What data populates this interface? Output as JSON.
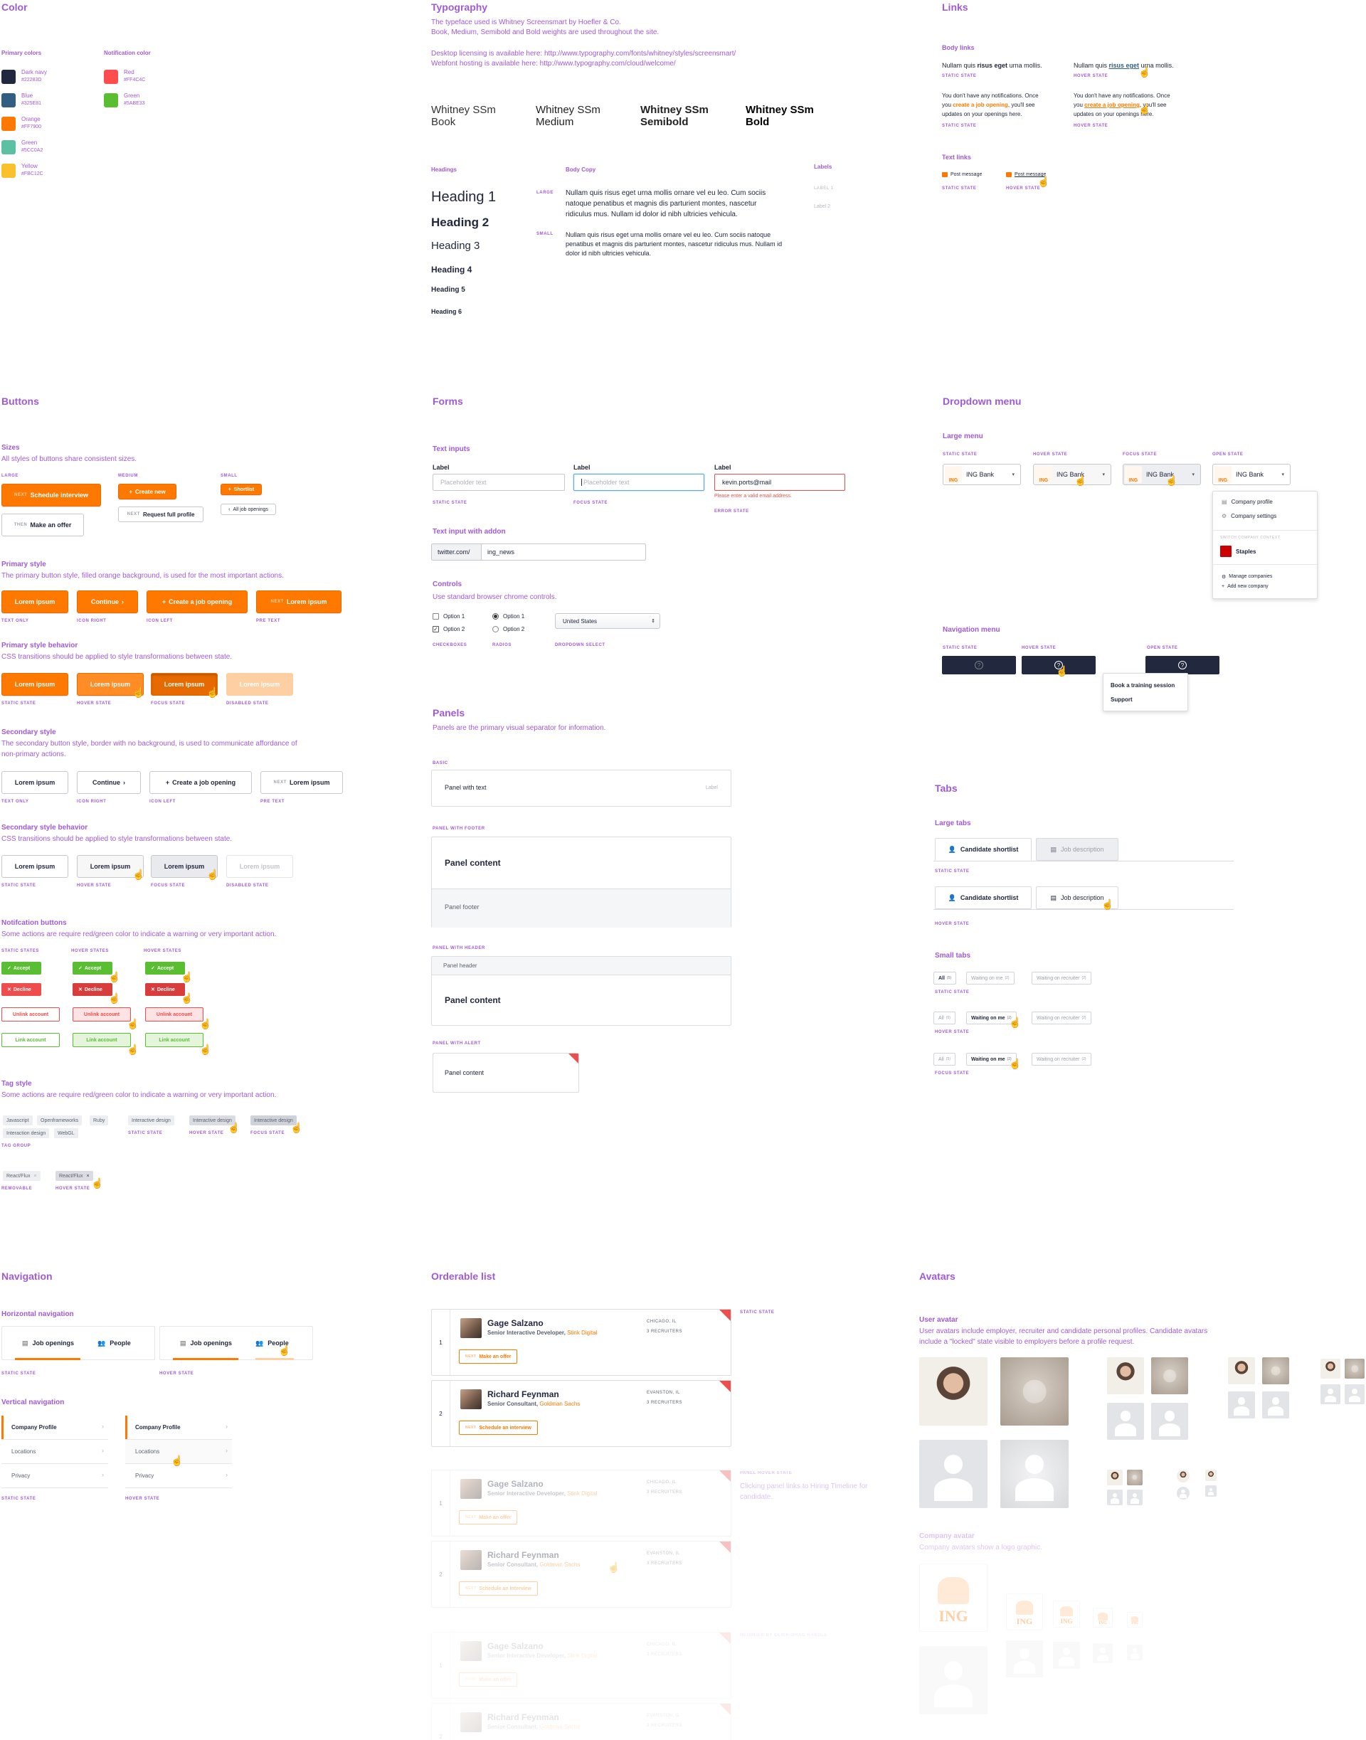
{
  "color": {
    "title": "Color",
    "primary_label": "Primary colors",
    "notification_label": "Notification color",
    "primary": [
      {
        "name": "Dark navy",
        "hex": "#22283D"
      },
      {
        "name": "Blue",
        "hex": "#325E81"
      },
      {
        "name": "Orange",
        "hex": "#FF7900"
      },
      {
        "name": "Green",
        "hex": "#5CC0A2"
      },
      {
        "name": "Yellow",
        "hex": "#FBC12C"
      }
    ],
    "notification": [
      {
        "name": "Red",
        "hex": "#FF4C4C"
      },
      {
        "name": "Green",
        "hex": "#5ABE33"
      }
    ]
  },
  "typography": {
    "title": "Typography",
    "intro1": "The typeface used is Whitney Screensmart by Hoefler & Co.",
    "intro2": "Book, Medium, Semibold and Bold weights are used throughout the site.",
    "link1": "Desktop licensing is available here: http://www.typography.com/fonts/whitney/styles/screensmart/",
    "link2": "Webfont hosting is available here: http://www.typography.com/cloud/welcome/",
    "weights": [
      "Whitney SSm Book",
      "Whitney SSm Medium",
      "Whitney SSm Semibold",
      "Whitney SSm Bold"
    ],
    "headings_label": "Headings",
    "headings": [
      "Heading 1",
      "Heading 2",
      "Heading 3",
      "Heading 4",
      "Heading 5",
      "Heading 6"
    ],
    "body_label": "Body Copy",
    "large_label": "LARGE",
    "small_label": "SMALL",
    "body_large": "Nullam quis risus eget urna mollis ornare vel eu leo. Cum sociis natoque penatibus et magnis dis parturient montes, nascetur ridiculus mus. Nullam id dolor id nibh ultricies vehicula.",
    "body_small": "Nullam quis risus eget urna mollis ornare vel eu leo. Cum sociis natoque penatibus et magnis dis parturient montes, nascetur ridiculus mus. Nullam id dolor id nibh ultricies vehicula.",
    "labels_label": "Labels",
    "label1": "LABEL 1",
    "label2": "Label 2"
  },
  "links": {
    "title": "Links",
    "body_links": "Body links",
    "body_pre": "Nullam quis ",
    "body_link": "risus eget",
    "body_post": " urna mollis.",
    "notif_pre": "You don't have any notifications. Once you ",
    "notif_link": "create a job opening",
    "notif_post": ", you'll see updates on your openings here.",
    "static": "STATIC STATE",
    "hover": "HOVER STATE",
    "text_links": "Text links",
    "post_message": "Post message"
  },
  "buttons": {
    "title": "Buttons",
    "sizes": "Sizes",
    "sizes_desc": "All styles of buttons share consistent sizes.",
    "large": "LARGE",
    "medium": "MEDIUM",
    "small": "SMALL",
    "next": "NEXT",
    "then": "THEN",
    "schedule": "Schedule interview",
    "make_offer": "Make an offer",
    "create_new": "Create new",
    "request_profile": "Request full profile",
    "shortlist": "Shortlist",
    "all_jobs": "All job openings",
    "primary_style": "Primary style",
    "primary_desc": "The primary button style, filled orange background, is used for the most important actions.",
    "lorem": "Lorem ipsum",
    "continue": "Continue",
    "create_job": "Create a job opening",
    "text_only": "TEXT ONLY",
    "icon_right": "ICON RIGHT",
    "icon_left": "ICON LEFT",
    "pre_text": "PRE TEXT",
    "primary_behavior": "Primary style behavior",
    "behavior_desc": "CSS transitions should be applied to style transformations between state.",
    "static_state": "STATIC STATE",
    "hover_state": "HOVER STATE",
    "focus_state": "FOCUS STATE",
    "disabled_state": "DISABLED STATE",
    "secondary_style": "Secondary style",
    "secondary_desc": "The secondary button style, border with no background, is used to communicate affordance of non-primary actions.",
    "secondary_behavior": "Secondary style behavior",
    "notification_buttons": "Notifcation buttons",
    "notification_desc": "Some actions are require red/green color to indicate a warning or very important action.",
    "static_states": "STATIC STATES",
    "hover_states": "HOVER STATES",
    "accept": "Accept",
    "decline": "Decline",
    "unlink": "Unlink account",
    "link": "Link account",
    "tag_style": "Tag style",
    "tag_desc": "Some actions are require red/green color to indicate a warning or very important action.",
    "tags": [
      "Javascript",
      "Openframeworks",
      "Ruby",
      "Interaction design",
      "WebGL"
    ],
    "tag_single": "Interactive design",
    "tag_group": "TAG GROUP",
    "removable_tag": "React/Flux",
    "removable": "REMOVABLE"
  },
  "forms": {
    "title": "Forms",
    "text_inputs": "Text inputs",
    "label": "Label",
    "placeholder": "Placeholder text",
    "value": "kevin.ports@mail",
    "error": "Please enter a valid email address.",
    "static": "STATIC STATE",
    "focus": "FOCUS STATE",
    "error_state": "ERROR STATE",
    "addon_title": "Text input with addon",
    "addon": "twitter.com/",
    "addon_value": "ing_news",
    "controls": "Controls",
    "controls_desc": "Use standard browser chrome controls.",
    "option1": "Option 1",
    "option2": "Option 2",
    "select_value": "United States",
    "checkboxes": "CHECKBOXES",
    "radios": "RADIOS",
    "dropdown_select": "DROPDOWN SELECT"
  },
  "panels": {
    "title": "Panels",
    "desc": "Panels are the primary visual separator for information.",
    "basic": "BASIC",
    "panel_text": "Panel with text",
    "panel_label": "Label",
    "with_footer": "PANEL WITH FOOTER",
    "content": "Panel content",
    "footer": "Panel footer",
    "with_header": "PANEL WITH HEADER",
    "header": "Panel header",
    "with_alert": "PANEL WITH ALERT"
  },
  "dropdown": {
    "title": "Dropdown menu",
    "large_menu": "Large menu",
    "static": "STATIC STATE",
    "hover": "HOVER STATE",
    "focus": "FOCUS STATE",
    "open": "OPEN STATE",
    "company": "ING Bank",
    "logo_text": "ING",
    "menu_items": [
      "Company profile",
      "Company settings"
    ],
    "switch_label": "SWITCH COMPANY CONTEXT",
    "other_company": "Staples",
    "manage": "Manage companies",
    "add": "Add new company",
    "nav_menu": "Navigation menu",
    "nav_items": [
      "Book a training session",
      "Support"
    ]
  },
  "tabs": {
    "title": "Tabs",
    "large_tabs": "Large tabs",
    "candidate": "Candidate shortlist",
    "job_desc": "Job description",
    "static": "STATIC STATE",
    "hover": "HOVER STATE",
    "focus": "FOCUS STATE",
    "small_tabs": "Small tabs",
    "all": "All",
    "all_count": "(5)",
    "waiting_me": "Waiting on me",
    "waiting_rec": "Waiting on recruiter",
    "count2": "(2)"
  },
  "navigation": {
    "title": "Navigation",
    "horizontal": "Horizontal navigation",
    "job_openings": "Job openings",
    "people": "People",
    "static": "STATIC STATE",
    "hover": "HOVER STATE",
    "vertical": "Vertical navigation",
    "vitems": [
      "Company Profile",
      "Locations",
      "Privacy"
    ]
  },
  "orderable": {
    "title": "Orderable list",
    "static": "STATIC STATE",
    "panel_hover": "PANEL HOVER STATE",
    "hover_desc": "Clicking panel links to Hiring Timeline for candidate.",
    "reorder": "REORDER BY CLICK-DRAG HANDLE",
    "items": [
      {
        "num": "1",
        "name": "Gage Salzano",
        "role": "Senior Interactive Developer,",
        "company": "Stink Digital",
        "loc": "CHICAGO, IL",
        "rec": "3 RECRUITERS",
        "pre": "NEXT",
        "action": "Make an offer"
      },
      {
        "num": "2",
        "name": "Richard Feynman",
        "role": "Senior Consultant,",
        "company": "Goldman Sachs",
        "loc": "EVANSTON, IL",
        "rec": "3 RECRUITERS",
        "pre": "NEXT",
        "action": "Schedule an interview"
      }
    ]
  },
  "avatars": {
    "title": "Avatars",
    "user_avatar": "User avatar",
    "user_desc": "User avatars include employer, recruiter and candidate personal profiles. Candidate avatars include a \"locked\" state visible to employers before a profile request.",
    "company_avatar": "Company avatar",
    "company_desc": "Company avatars show a logo graphic.",
    "logo_text": "ING"
  }
}
